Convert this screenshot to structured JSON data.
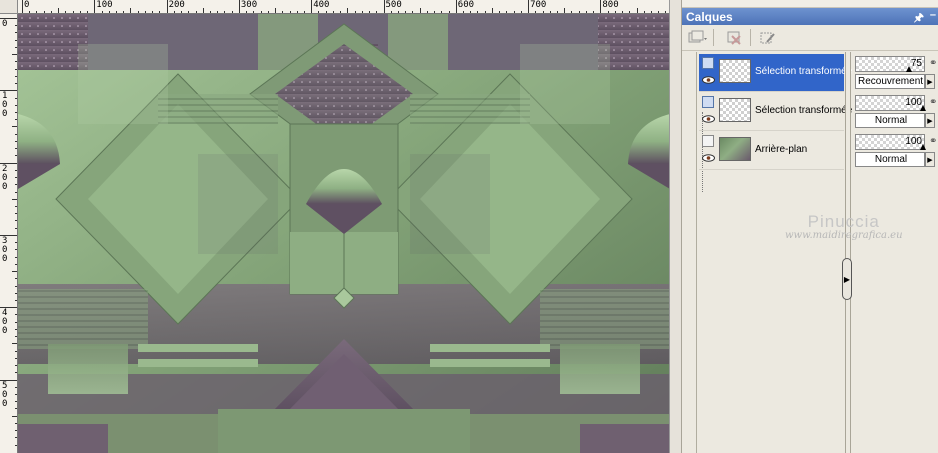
{
  "panel": {
    "title": "Calques",
    "pin_icon": "pin-icon",
    "minimize_icon": "minimize-icon",
    "toolbar": [
      {
        "icon": "new-layer-icon"
      },
      {
        "icon": "delete-layer-icon"
      },
      {
        "icon": "edit-selection-icon"
      }
    ]
  },
  "layers": [
    {
      "name": "Sélection transformée",
      "selected": true,
      "opacity": "75",
      "blend": "Recouvrement"
    },
    {
      "name": "Sélection transformée",
      "selected": false,
      "opacity": "100",
      "blend": "Normal"
    },
    {
      "name": "Arrière-plan",
      "selected": false,
      "opacity": "100",
      "blend": "Normal"
    }
  ],
  "ruler": {
    "h_labels": [
      "0",
      "100",
      "200",
      "300",
      "400",
      "500",
      "600",
      "700",
      "800"
    ],
    "v_labels": [
      "0",
      "1 0 0",
      "2 0 0",
      "3 0 0",
      "4 0 0",
      "5 0 0"
    ]
  },
  "watermark": {
    "title": "Pinuccia",
    "url": "www.maidiregrafica.eu"
  },
  "colors": {
    "green": "#8fb184",
    "mauve": "#6f6070",
    "selection": "#3165c9",
    "title_bar": "#5a80c2"
  }
}
